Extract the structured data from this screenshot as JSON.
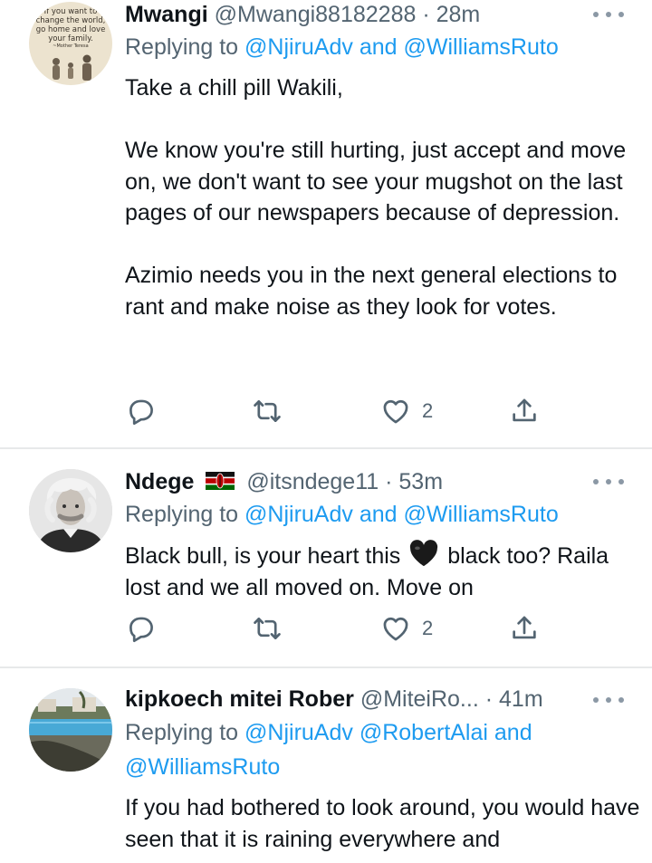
{
  "tweets": [
    {
      "name": "Mwangi",
      "handle": "@Mwangi88182288",
      "time": "· 28m",
      "replying_prefix": "Replying to ",
      "reply_mentions": [
        "@NjiruAdv",
        "@WilliamsRuto"
      ],
      "reply_line2": "",
      "avatar_text": [
        "If you want to",
        "change the world,",
        "go home and love",
        "your family.",
        "~Mother Teresa"
      ],
      "paragraphs": [
        "Take a chill pill Wakili,",
        "We know you're still hurting, just accept and move on,  we don't want to see your mugshot on the last pages of our newspapers because of depression.",
        "Azimio needs you in the next general elections to rant and make noise as they look for votes."
      ],
      "like_count": "2"
    },
    {
      "name": "Ndege",
      "handle": "@itsndege11",
      "time": "· 53m",
      "replying_prefix": "Replying to ",
      "reply_mentions": [
        "@NjiruAdv",
        "@WilliamsRuto"
      ],
      "text_before_emoji": "Black bull, is your heart this ",
      "text_after_emoji": " black too? Raila lost and we all moved on. Move on",
      "emoji": "black-heart",
      "like_count": "2"
    },
    {
      "name": "kipkoech mitei Rober",
      "handle": "@MiteiRo...",
      "time": "· 41m",
      "replying_prefix": "Replying to ",
      "reply_mentions": [
        "@NjiruAdv",
        "@RobertAlai",
        "@WilliamsRuto"
      ],
      "paragraphs": [
        "If you had bothered to look around, you would have seen that it is raining everywhere and"
      ]
    }
  ],
  "connector": "and",
  "icons": {
    "reply": "reply-icon",
    "retweet": "retweet-icon",
    "like": "like-icon",
    "share": "share-icon",
    "more": "more-icon",
    "flag": "kenya-flag-icon"
  },
  "colors": {
    "link": "#1d9bf0",
    "secondary": "#536471",
    "divider": "#e7e9ea",
    "text": "#0f1419"
  }
}
